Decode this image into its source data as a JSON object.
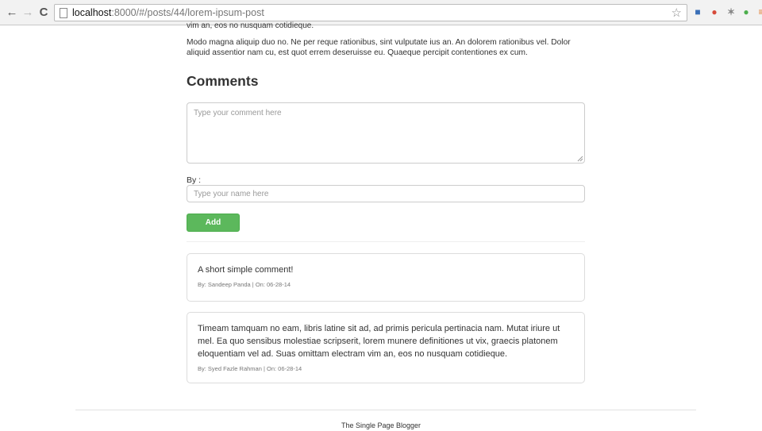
{
  "browser": {
    "url_host": "localhost",
    "url_rest": ":8000/#/posts/44/lorem-ipsum-post",
    "back_icon": "←",
    "forward_icon": "→",
    "reload_icon": "C",
    "bookmark_icon": "☆",
    "extensions": [
      {
        "name": "extension-1-icon",
        "glyph": "■",
        "color": "#3a6fb7"
      },
      {
        "name": "extension-2-icon",
        "glyph": "●",
        "color": "#d64a3a"
      },
      {
        "name": "extension-3-icon",
        "glyph": "✶",
        "color": "#888888"
      },
      {
        "name": "extension-4-icon",
        "glyph": "●",
        "color": "#4cae4c"
      },
      {
        "name": "menu-icon",
        "glyph": "≡",
        "color": "#e0792b"
      }
    ]
  },
  "post": {
    "para_top": "vim an, eos no nusquam cotidieque.",
    "para": "Modo magna aliquip duo no. Ne per reque rationibus, sint vulputate ius an. An dolorem rationibus vel. Dolor aliquid assentior nam cu, est quot errem deseruisse eu. Quaeque percipit contentiones ex cum."
  },
  "comments_section": {
    "heading": "Comments",
    "textarea_placeholder": "Type your comment here",
    "by_label": "By :",
    "name_placeholder": "Type your name here",
    "add_label": "Add"
  },
  "comments": [
    {
      "body": "A short simple comment!",
      "meta": "By: Sandeep Panda | On: 06-28-14"
    },
    {
      "body": "Timeam tamquam no eam, libris latine sit ad, ad primis pericula pertinacia nam. Mutat iriure ut mel. Ea quo sensibus molestiae scripserit, lorem munere definitiones ut vix, graecis platonem eloquentiam vel ad. Suas omittam electram vim an, eos no nusquam cotidieque.",
      "meta": "By: Syed Fazle Rahman | On: 06-28-14"
    }
  ],
  "footer": {
    "text": "The Single Page Blogger"
  }
}
